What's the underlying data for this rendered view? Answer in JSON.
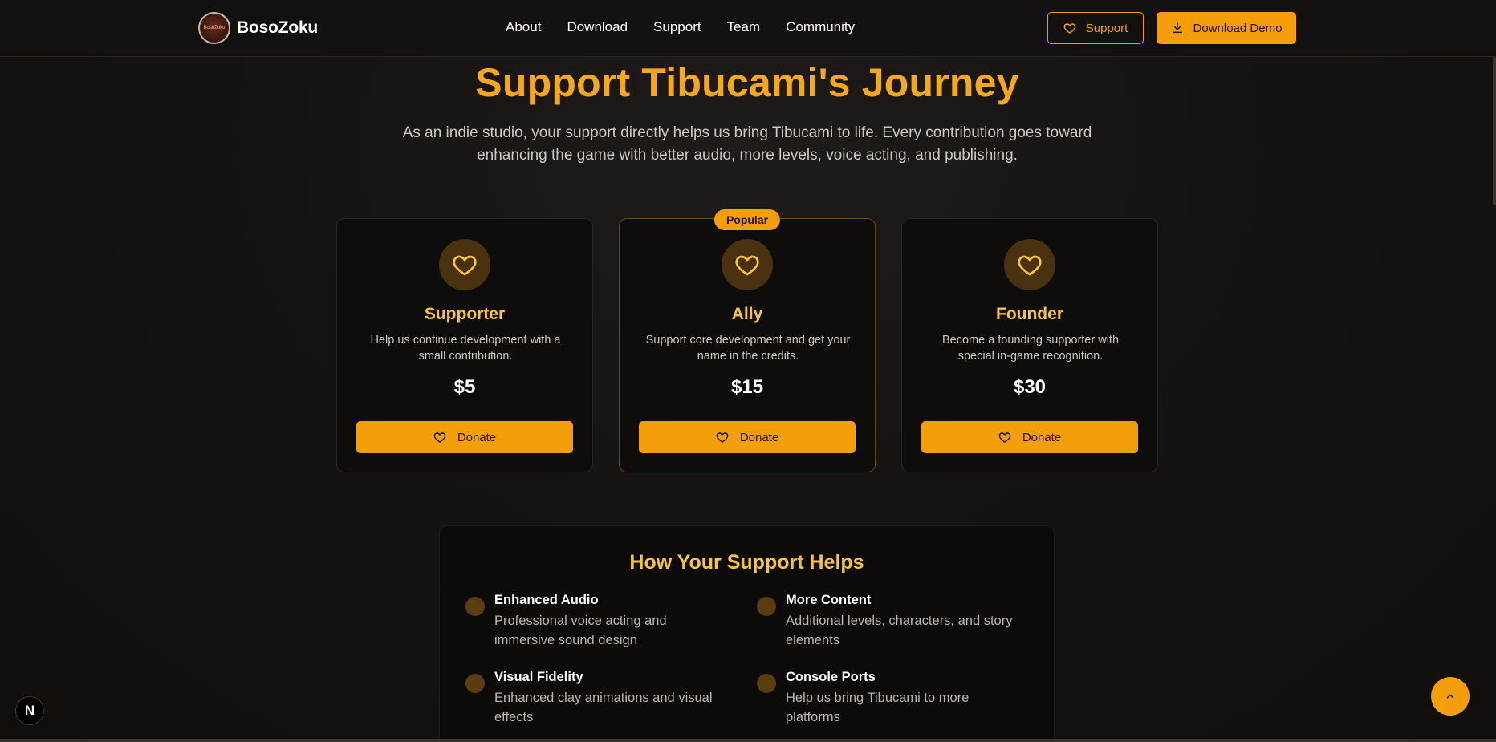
{
  "brand": {
    "name": "BosoZoku",
    "logo_text": "BosoZoku"
  },
  "nav": {
    "links": [
      "About",
      "Download",
      "Support",
      "Team",
      "Community"
    ]
  },
  "header_buttons": {
    "support_label": "Support",
    "download_label": "Download Demo"
  },
  "hero": {
    "title": "Support Tibucami's Journey",
    "subtitle": "As an indie studio, your support directly helps us bring Tibucami to life. Every contribution goes toward enhancing the game with better audio, more levels, voice acting, and publishing."
  },
  "tiers": [
    {
      "name": "Supporter",
      "description": "Help us continue development with a small contribution.",
      "price": "$5",
      "button": "Donate",
      "badge": ""
    },
    {
      "name": "Ally",
      "description": "Support core development and get your name in the credits.",
      "price": "$15",
      "button": "Donate",
      "badge": "Popular"
    },
    {
      "name": "Founder",
      "description": "Become a founding supporter with special in-game recognition.",
      "price": "$30",
      "button": "Donate",
      "badge": ""
    }
  ],
  "helps": {
    "title": "How Your Support Helps",
    "items": [
      {
        "title": "Enhanced Audio",
        "description": "Professional voice acting and immersive sound design"
      },
      {
        "title": "More Content",
        "description": "Additional levels, characters, and story elements"
      },
      {
        "title": "Visual Fidelity",
        "description": "Enhanced clay animations and visual effects"
      },
      {
        "title": "Console Ports",
        "description": "Help us bring Tibucami to more platforms"
      }
    ]
  },
  "misc": {
    "dev_badge": "N"
  },
  "colors": {
    "accent": "#f59e0b",
    "tier_name": "#f7c53b",
    "background": "#161312"
  },
  "icons": {
    "card": "heart-icon",
    "donate": "heart-icon",
    "support": "heart-icon",
    "download": "download-icon",
    "scroll_top": "chevron-up-icon"
  }
}
